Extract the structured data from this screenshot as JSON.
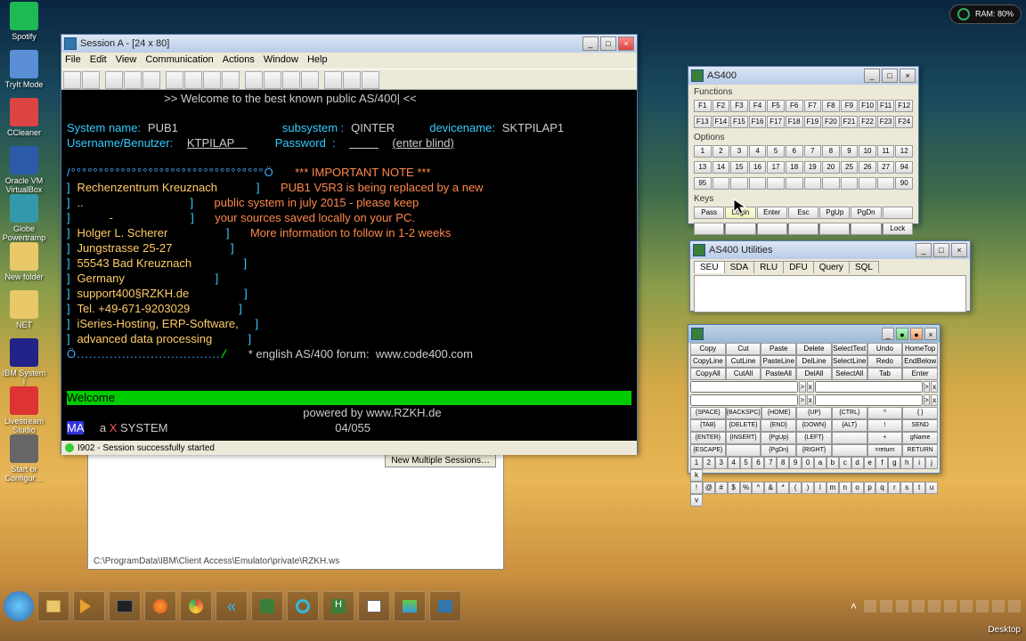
{
  "ram": {
    "label": "RAM:",
    "value": "80%"
  },
  "desktop_icons": [
    {
      "label": "Spotify",
      "color": "#1db954"
    },
    {
      "label": "TryIt Mode",
      "color": "#5a8fd6"
    },
    {
      "label": "CCleaner",
      "color": "#d44"
    },
    {
      "label": "Oracle VM VirtualBox",
      "color": "#2a5aa8"
    },
    {
      "label": "Globe Powertramp",
      "color": "#39a"
    },
    {
      "label": "New folder",
      "color": "#e8c868"
    },
    {
      "label": "NET",
      "color": "#e8c868"
    },
    {
      "label": "IBM System i",
      "color": "#228"
    },
    {
      "label": "Livestream Studio",
      "color": "#d33"
    },
    {
      "label": "Start or Configur…",
      "color": "#666"
    }
  ],
  "sessionA": {
    "title": "Session A - [24 x 80]",
    "menu": [
      "File",
      "Edit",
      "View",
      "Communication",
      "Actions",
      "Window",
      "Help"
    ],
    "status": "I902 - Session successfully started",
    "pos": "04/055"
  },
  "term": {
    "banner": ">> Welcome to the best known public AS/400| <<",
    "sys_lbl": "System name:",
    "sys_val": "PUB1",
    "subsys_lbl": "subsystem :",
    "subsys_val": "QINTER",
    "dev_lbl": "devicename:",
    "dev_val": "SKTPILAP1",
    "user_lbl": "Username/Benutzer:",
    "user_val": "KTPILAP",
    "pass_lbl": "Password  :",
    "pass_hint": "(enter blind)",
    "box_top": "/°°°°°°°°°°°°°°°°°°°°°°°°°°°°°°°°°°°Ö",
    "box_bot": "Ö...................................",
    "addr": [
      "Rechenzentrum Kreuznach",
      "..",
      "          -",
      "Holger L. Scherer",
      "Jungstrasse 25-27",
      "55543 Bad Kreuznach",
      "Germany",
      "support400§RZKH.de",
      "Tel. +49-671-9203029",
      "iSeries-Hosting, ERP-Software,",
      "advanced data processing"
    ],
    "note_hdr": "*** IMPORTANT NOTE ***",
    "note1": "PUB1 V5R3 is being replaced by a new",
    "note2": "public system in july 2015 - please keep",
    "note3": "your sources saved locally on your PC.",
    "note4": "More information to follow in 1-2 weeks",
    "forum": "* english AS/400 forum:  www.code400.com",
    "welcome": "Welcome",
    "powered": "powered by www.RZKH.de",
    "status_left": "MA",
    "status_a": "a",
    "status_x": "X",
    "status_sys": "SYSTEM"
  },
  "as400": {
    "title": "AS400",
    "sec1": "Functions",
    "fkeys1": [
      "F1",
      "F2",
      "F3",
      "F4",
      "F5",
      "F6",
      "F7",
      "F8",
      "F9",
      "F10",
      "F11",
      "F12"
    ],
    "fkeys2": [
      "F13",
      "F14",
      "F15",
      "F16",
      "F17",
      "F18",
      "F19",
      "F20",
      "F21",
      "F22",
      "F23",
      "F24"
    ],
    "sec2": "Options",
    "opts1": [
      "1",
      "2",
      "3",
      "4",
      "5",
      "6",
      "7",
      "8",
      "9",
      "10",
      "11",
      "12"
    ],
    "opts2": [
      "13",
      "14",
      "15",
      "16",
      "17",
      "18",
      "19",
      "20",
      "25",
      "26",
      "27",
      "94"
    ],
    "opts3": [
      "95",
      "",
      "",
      "",
      "",
      "",
      "",
      "",
      "",
      "",
      "",
      "90"
    ],
    "sec3": "Keys",
    "keys1": [
      "Pass",
      "Login",
      "Enter",
      "Esc",
      "PgUp",
      "PgDn",
      ""
    ],
    "keys2": [
      "",
      "",
      "",
      "",
      "",
      "",
      "Lock"
    ]
  },
  "util": {
    "title": "AS400 Utilities",
    "tabs": [
      "SEU",
      "SDA",
      "RLU",
      "DFU",
      "Query",
      "SQL"
    ]
  },
  "kbd": {
    "row1": [
      "Copy",
      "Cut",
      "Paste",
      "Delete",
      "SelectText",
      "Undo",
      "HomeTop"
    ],
    "row2": [
      "CopyLine",
      "CutLine",
      "PasteLine",
      "DelLine",
      "SelectLine",
      "Redo",
      "EndBelow"
    ],
    "row3": [
      "CopyAll",
      "CutAll",
      "PasteAll",
      "DelAll",
      "SelectAll",
      "Tab",
      "Enter"
    ],
    "mrow1": [
      "{SPACE}",
      "{BACKSPC}",
      "{HOME}",
      "{UP}",
      "{CTRL}",
      "^",
      "{ }"
    ],
    "mrow2": [
      "{TAB}",
      "{DELETE}",
      "{END}",
      "{DOWN}",
      "{ALT}",
      "!",
      "SEND"
    ],
    "mrow3": [
      "{ENTER}",
      "{INSERT}",
      "{PgUp}",
      "{LEFT}",
      "",
      "+",
      "gName"
    ],
    "mrow4": [
      "{ESCAPE}",
      "",
      "{PgDn}",
      "{RIGHT}",
      "",
      "=return",
      "RETURN"
    ],
    "chars1": [
      "1",
      "2",
      "3",
      "4",
      "5",
      "6",
      "7",
      "8",
      "9",
      "0",
      "a",
      "b",
      "c",
      "d",
      "e",
      "f",
      "g",
      "h",
      "i",
      "j",
      "k"
    ],
    "chars2": [
      "!",
      "@",
      "#",
      "$",
      "%",
      "^",
      "&",
      "*",
      "(",
      ")",
      "l",
      "m",
      "n",
      "o",
      "p",
      "q",
      "r",
      "s",
      "t",
      "u",
      "v"
    ]
  },
  "bg": {
    "button": "New Multiple Sessions…",
    "path": "C:\\ProgramData\\IBM\\Client Access\\Emulator\\private\\RZKH.ws"
  },
  "desktop_label": "Desktop"
}
